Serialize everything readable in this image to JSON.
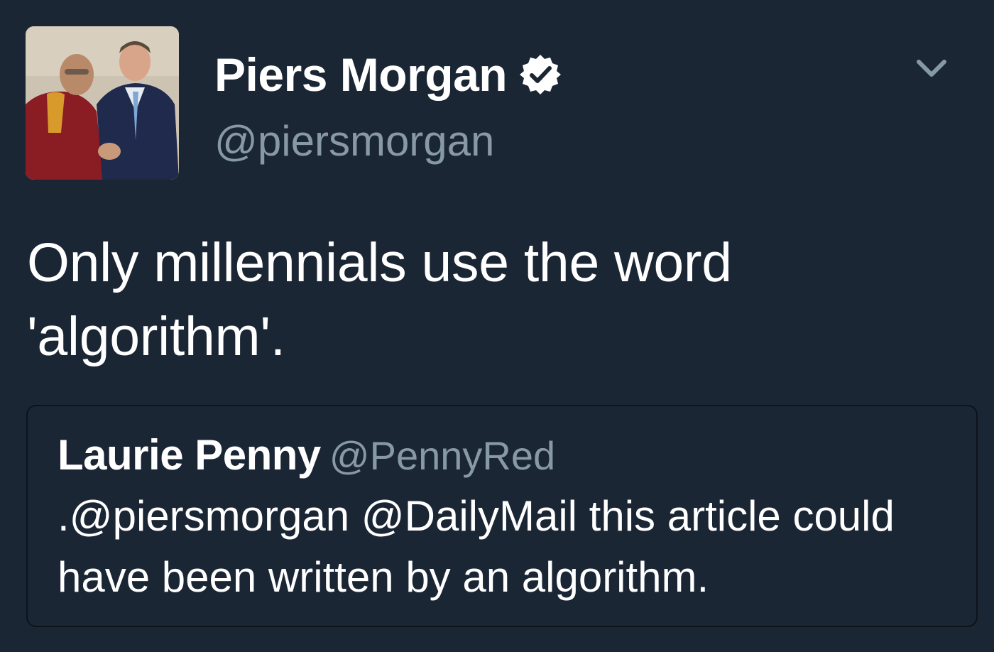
{
  "tweet": {
    "author": {
      "display_name": "Piers Morgan",
      "handle": "@piersmorgan",
      "verified": true
    },
    "text": "Only millennials use the word 'algorithm'.",
    "menu_icon": "chevron-down-icon"
  },
  "quoted_tweet": {
    "display_name": "Laurie Penny",
    "handle": "@PennyRed",
    "text": ".@piersmorgan @DailyMail this article could have been written by an algorithm."
  },
  "colors": {
    "background": "#1b2635",
    "text": "#ffffff",
    "secondary": "#8899a6",
    "quote_border": "#0d131b"
  }
}
